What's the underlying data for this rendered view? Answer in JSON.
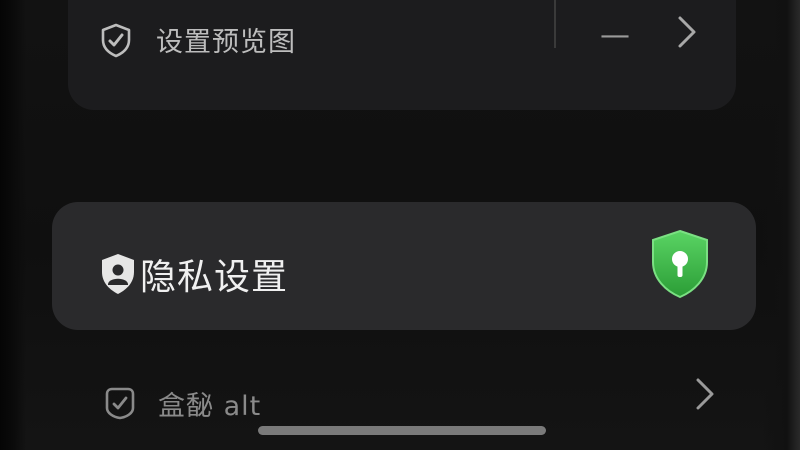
{
  "top_card": {
    "row_label": "设置预览图",
    "dash": "—",
    "icon": "shield-check-icon",
    "chevron": "chevron-right-icon"
  },
  "privacy_card": {
    "title": "隐私设置",
    "icon": "shield-user-icon",
    "status_icon": "green-shield-icon",
    "accent": "#3ec04a"
  },
  "bottom_row": {
    "label": "盒馝 alt",
    "icon": "check-shield-icon",
    "chevron": "chevron-right-icon"
  }
}
